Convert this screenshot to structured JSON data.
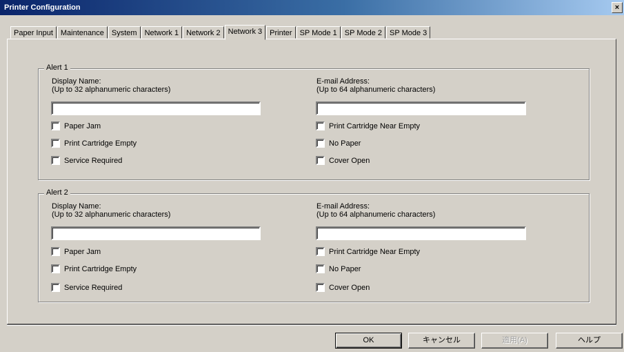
{
  "window": {
    "title": "Printer Configuration",
    "close_glyph": "×"
  },
  "tabs": [
    {
      "label": "Paper Input"
    },
    {
      "label": "Maintenance"
    },
    {
      "label": "System"
    },
    {
      "label": "Network 1"
    },
    {
      "label": "Network 2"
    },
    {
      "label": "Network 3",
      "active": true
    },
    {
      "label": "Printer"
    },
    {
      "label": "SP Mode 1"
    },
    {
      "label": "SP Mode 2"
    },
    {
      "label": "SP Mode 3"
    }
  ],
  "alerts": [
    {
      "legend": "Alert 1",
      "display_name_label_1": "Display Name:",
      "display_name_label_2": "(Up to 32 alphanumeric characters)",
      "display_name_value": "",
      "email_label_1": "E-mail Address:",
      "email_label_2": "(Up to 64 alphanumeric characters)",
      "email_value": "",
      "checks_left": [
        "Paper Jam",
        "Print Cartridge Empty",
        "Service Required"
      ],
      "checks_right": [
        "Print Cartridge Near Empty",
        "No Paper",
        "Cover Open"
      ]
    },
    {
      "legend": "Alert 2",
      "display_name_label_1": "Display Name:",
      "display_name_label_2": "(Up to 32 alphanumeric characters)",
      "display_name_value": "",
      "email_label_1": "E-mail Address:",
      "email_label_2": "(Up to 64 alphanumeric characters)",
      "email_value": "",
      "checks_left": [
        "Paper Jam",
        "Print Cartridge Empty",
        "Service Required"
      ],
      "checks_right": [
        "Print Cartridge Near Empty",
        "No Paper",
        "Cover Open"
      ]
    }
  ],
  "buttons": {
    "ok": "OK",
    "cancel": "キャンセル",
    "apply": "適用(A)",
    "help": "ヘルプ"
  },
  "colors": {
    "titlebar_start": "#0a246a",
    "titlebar_end": "#a6caf0",
    "face": "#d4d0c8"
  }
}
